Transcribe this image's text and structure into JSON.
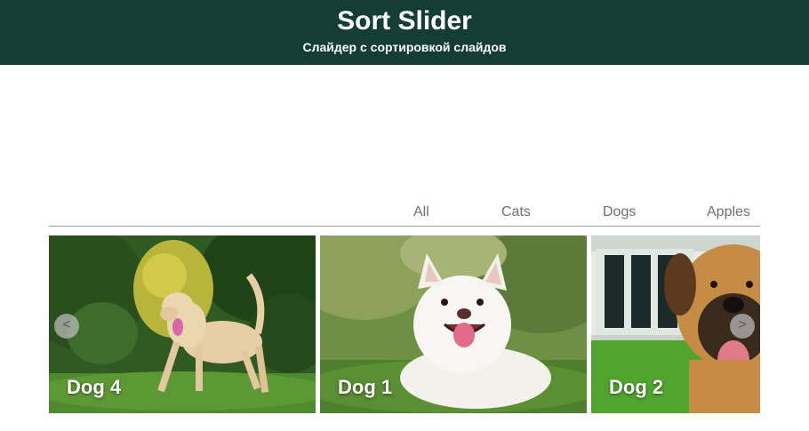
{
  "header": {
    "title": "Sort Slider",
    "subtitle": "Слайдер с сортировкой слайдов",
    "background": "#143d35"
  },
  "filters": {
    "all": "All",
    "cats": "Cats",
    "dogs": "Dogs",
    "apples": "Apples"
  },
  "slides": [
    {
      "label": "Dog 4",
      "image": "yellow labrador on grass"
    },
    {
      "label": "Dog 1",
      "image": "white fluffy dog lying on grass"
    },
    {
      "label": "Dog 2",
      "image": "mastiff dog in front of house"
    }
  ],
  "nav": {
    "prev_label": "<",
    "next_label": ">",
    "prev_icon": "chevron-left-icon",
    "next_icon": "chevron-right-icon"
  }
}
